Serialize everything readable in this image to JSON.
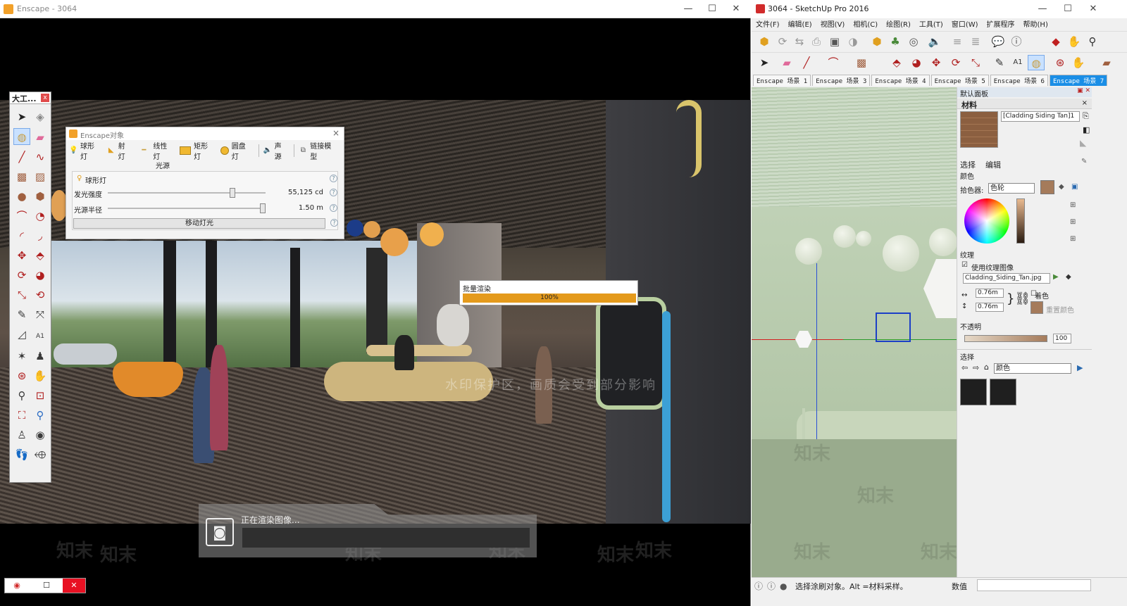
{
  "enscape": {
    "title": "Enscape - 3064",
    "window_controls": {
      "minimize": "—",
      "maximize": "☐",
      "close": "✕"
    },
    "tool_palette": {
      "title": "大工...",
      "close": "x",
      "tools": [
        "select",
        "component",
        "paint-bucket",
        "eraser",
        "pencil",
        "freehand",
        "rectangle",
        "rotated-rect",
        "circle",
        "polygon",
        "arc",
        "pie",
        "arc2",
        "arc3",
        "move",
        "push-pull",
        "rotate",
        "follow-me",
        "scale",
        "offset",
        "tape-measure",
        "dimension",
        "protractor",
        "text",
        "axes",
        "3d-text",
        "orbit",
        "pan",
        "zoom",
        "zoom-window",
        "zoom-extents",
        "previous",
        "walk",
        "look-around",
        "position-camera",
        "section-plane"
      ]
    },
    "objects_dialog": {
      "title": "Enscape对象",
      "close": "×",
      "light_types": [
        {
          "icon": "bulb-icon",
          "label": "球形灯"
        },
        {
          "icon": "spotlight-icon",
          "label": "射灯"
        },
        {
          "icon": "line-light-icon",
          "label": "线性灯"
        },
        {
          "icon": "rect-light-icon",
          "label": "矩形灯"
        },
        {
          "icon": "disk-light-icon",
          "label": "圆盘灯"
        },
        {
          "icon": "speaker-icon",
          "label": "声源"
        },
        {
          "icon": "link-model-icon",
          "label": "链接模型"
        }
      ],
      "section": "光源",
      "selected_type": "球形灯",
      "intensity": {
        "label": "发光强度",
        "value": "55,125 cd",
        "fraction": 0.79
      },
      "radius": {
        "label": "光源半径",
        "value": "1.50 m",
        "fraction": 0.98
      },
      "move_button": "移动灯光",
      "help": "?"
    },
    "watermark": "水印保护区，画质会受到部分影响",
    "watermark_logo": "知末",
    "batch_render": {
      "title": "批量渲染",
      "progress_text": "100%",
      "progress": 1.0
    },
    "render_overlay": {
      "message": "正在渲染图像...",
      "icon": "camera-icon"
    },
    "taskbar": {
      "icon": "enscape-icon",
      "restore": "☐",
      "close": "✕"
    }
  },
  "sketchup": {
    "title": "3064 - SketchUp Pro 2016",
    "window_controls": {
      "minimize": "—",
      "maximize": "☐",
      "close": "✕"
    },
    "menu": [
      "文件(F)",
      "编辑(E)",
      "视图(V)",
      "相机(C)",
      "绘图(R)",
      "工具(T)",
      "窗口(W)",
      "扩展程序",
      "帮助(H)"
    ],
    "scene_tabs": [
      "Enscape 场景 1",
      "Enscape 场景 3",
      "Enscape 场景 4",
      "Enscape 场景 5",
      "Enscape 场景 6",
      "Enscape 场景 7"
    ],
    "active_scene": 5,
    "tray": {
      "title": "默认面板",
      "materials_title": "材料",
      "material_name": "[Cladding Siding Tan]1",
      "tab_select": "选择",
      "tab_edit": "编辑",
      "color_label": "颜色",
      "picker_label": "拾色器:",
      "picker_value": "色轮",
      "texture_label": "纹理",
      "use_texture": "使用纹理图像",
      "texture_file": "Cladding_Siding_Tan.jpg",
      "width": "0.76m",
      "height": "0.76m",
      "colorize": "着色",
      "reset_color": "重置颜色",
      "opacity_label": "不透明",
      "opacity_value": "100",
      "select_section": "选择",
      "select_dropdown": "颜色",
      "swatch_color": "#a57b5b"
    },
    "status": {
      "message": "选择涂刷对象。Alt =材料采样。",
      "value_label": "数值",
      "value": ""
    }
  }
}
